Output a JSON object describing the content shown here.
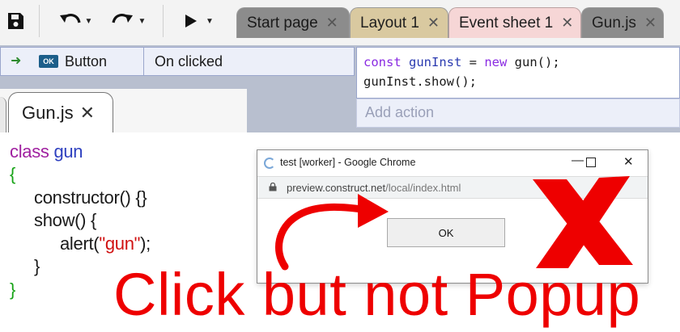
{
  "tabs": [
    {
      "label": "Start page",
      "close": "✕"
    },
    {
      "label": "Layout 1",
      "close": "✕"
    },
    {
      "label": "Event sheet 1",
      "close": "✕"
    },
    {
      "label": "Gun.js",
      "close": "✕"
    }
  ],
  "event": {
    "object_badge": "OK",
    "object_name": "Button",
    "condition": "On clicked",
    "action_code": {
      "line1": {
        "kw_const": "const",
        "var": "gunInst",
        "eq": " = ",
        "kw_new": "new",
        "call": " gun();"
      },
      "line2": "gunInst.show();"
    },
    "add_action": "Add action"
  },
  "editor": {
    "tab_label": "Gun.js",
    "tab_close": "✕",
    "code": {
      "l1_kw": "class",
      "l1_name": "gun",
      "l2": "{",
      "l3": "constructor() {}",
      "l4": "show() {",
      "l5_pre": "alert(",
      "l5_str": "\"gun\"",
      "l5_post": ");",
      "l6": "}",
      "l7": "}"
    }
  },
  "popup": {
    "title": "test [worker] - Google Chrome",
    "url_host": "preview.construct.net",
    "url_path": "/local/index.html",
    "ok_label": "OK"
  },
  "overlay": {
    "caption": "Click but not Popup",
    "color": "#ee0000"
  }
}
